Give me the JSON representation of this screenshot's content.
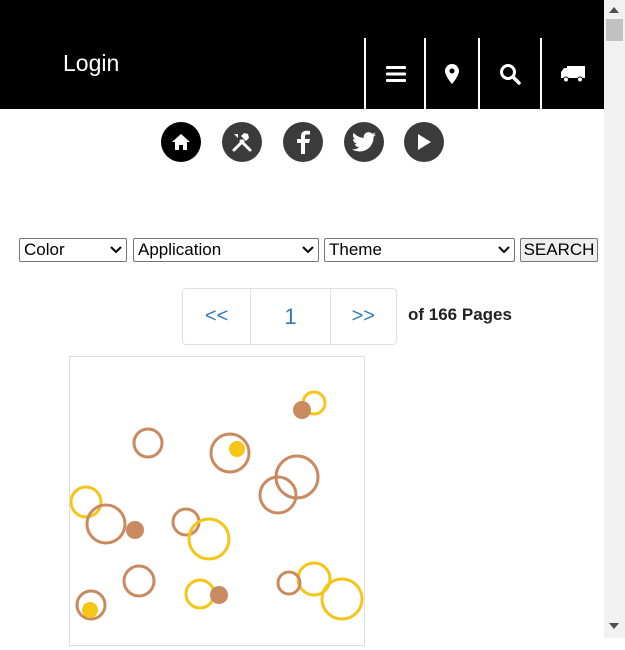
{
  "header": {
    "login_label": "Login",
    "icons": [
      "menu-icon",
      "location-pin-icon",
      "search-icon",
      "truck-icon"
    ]
  },
  "social": [
    "home-icon",
    "tools-icon",
    "facebook-icon",
    "twitter-icon",
    "play-icon"
  ],
  "filters": {
    "color": "Color",
    "application": "Application",
    "theme": "Theme",
    "search_label": "SEARCH"
  },
  "pagination": {
    "prev": "<<",
    "current": "1",
    "next": ">>",
    "info": "of 166 Pages"
  },
  "colors": {
    "accent_tan": "#c98a5f",
    "accent_yellow": "#f5c518",
    "link": "#337ab7"
  }
}
